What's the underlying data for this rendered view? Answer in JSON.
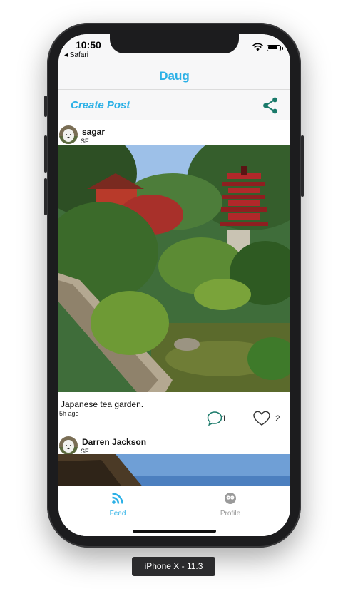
{
  "status_bar": {
    "time": "10:50",
    "back_app": "◂ Safari",
    "signal": "····"
  },
  "navbar": {
    "title": "Daug"
  },
  "toolbar": {
    "create_post_label": "Create Post"
  },
  "posts": [
    {
      "user": "sagar",
      "location": "SF",
      "caption": "Japanese tea garden.",
      "time_ago": "5h ago",
      "comments": "1",
      "likes": "2"
    },
    {
      "user": "Darren Jackson",
      "location": "SF"
    }
  ],
  "tabs": [
    {
      "label": "Feed",
      "icon": "rss-icon",
      "active": true
    },
    {
      "label": "Profile",
      "icon": "profile-icon",
      "active": false
    }
  ],
  "device_label": "iPhone X - 11.3",
  "colors": {
    "accent": "#2bb0e6",
    "share": "#1a7a6a",
    "inactive": "#9a9a9a"
  }
}
